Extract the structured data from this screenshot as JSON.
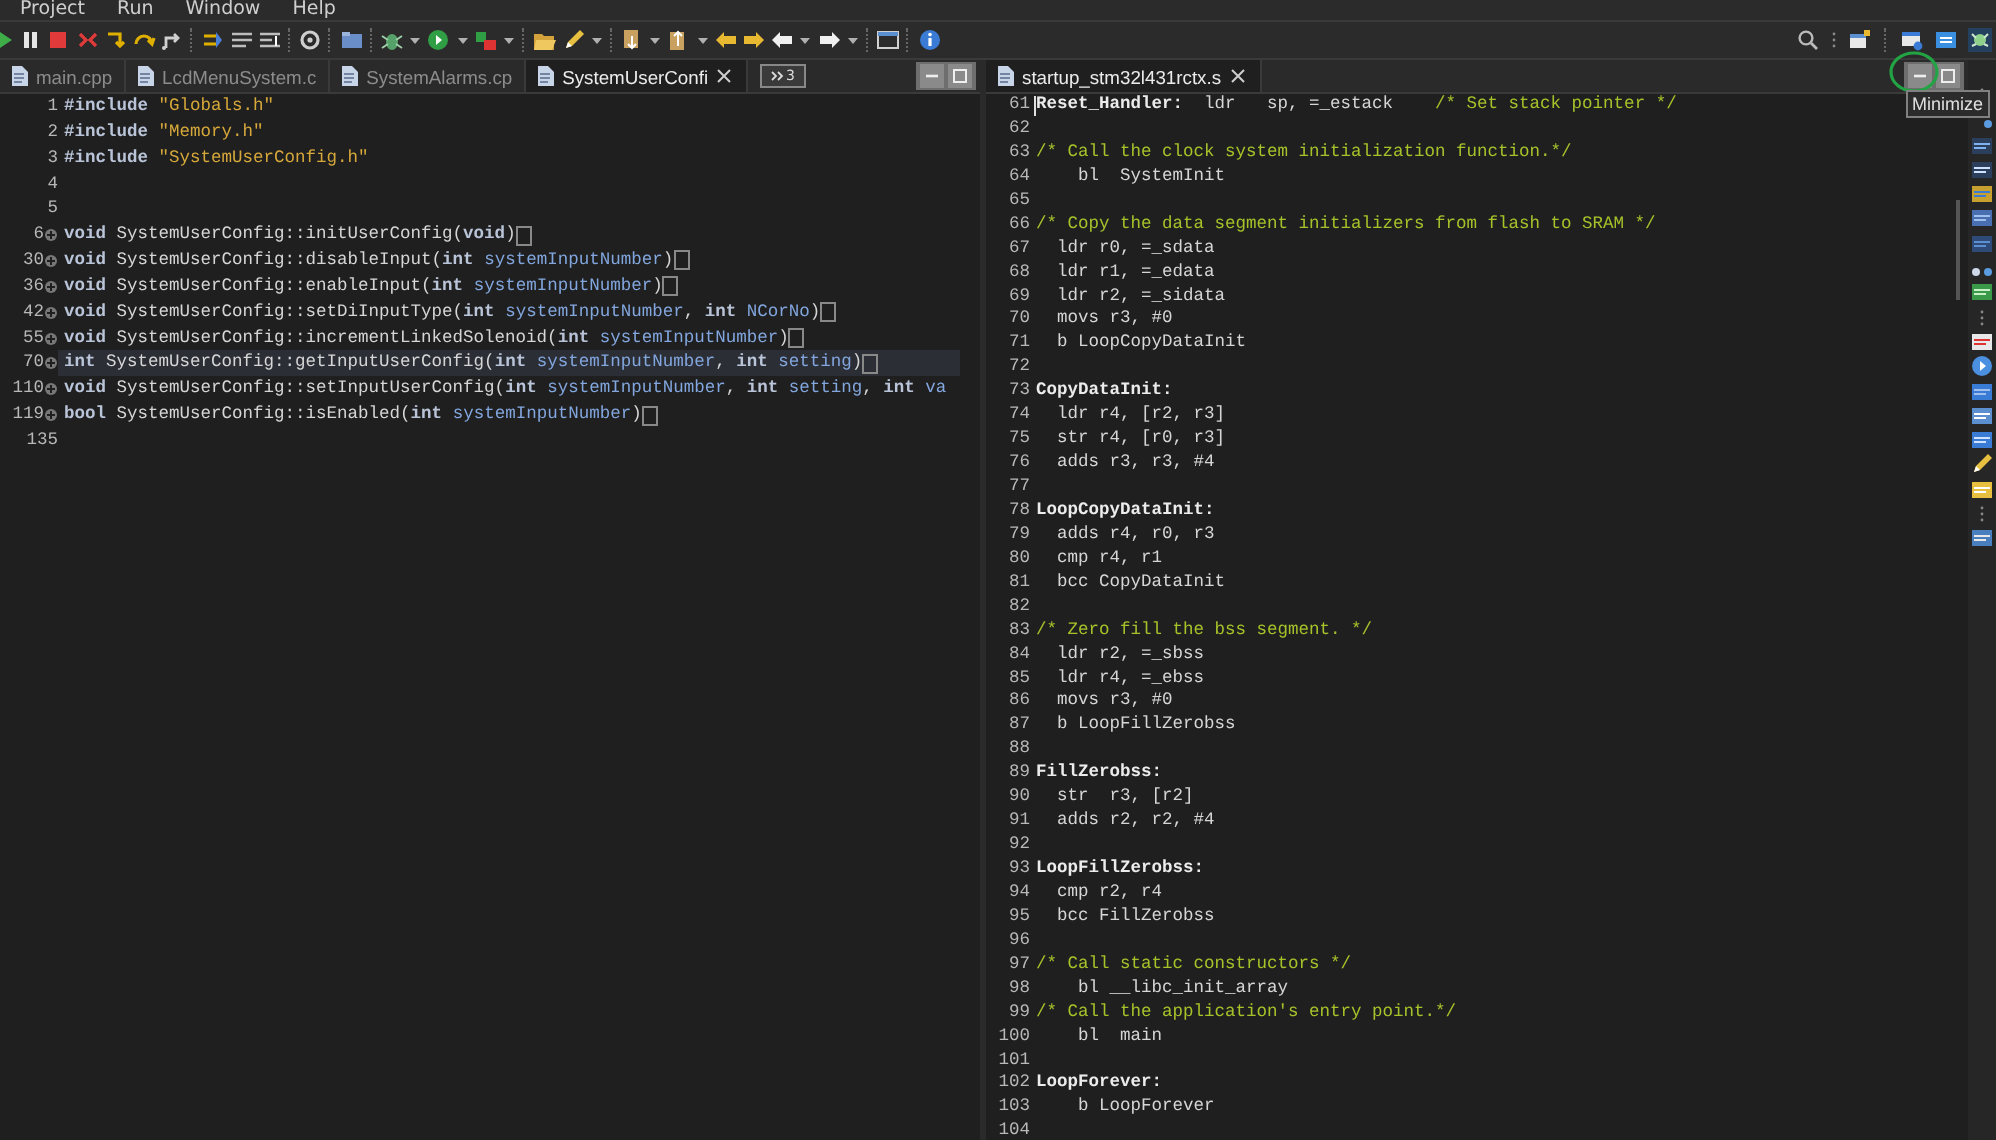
{
  "menu": [
    {
      "label": "Project"
    },
    {
      "label": "Run"
    },
    {
      "label": "Window"
    },
    {
      "label": "Help"
    }
  ],
  "editors": [
    {
      "tabs": [
        {
          "label": "main.cpp",
          "selected": false
        },
        {
          "label": "LcdMenuSystem.c",
          "selected": false
        },
        {
          "label": "SystemAlarms.cp",
          "selected": false
        },
        {
          "label": "SystemUserConfi",
          "selected": true
        }
      ],
      "overflow_count": "3",
      "lines": [
        {
          "number": "1",
          "collapsed": false,
          "current": false,
          "cursor": false,
          "segments": [
            {
              "kind": "keyword",
              "text": "#include"
            },
            {
              "kind": "string",
              "text": " \"Globals.h\""
            }
          ]
        },
        {
          "number": "2",
          "collapsed": false,
          "current": false,
          "cursor": false,
          "segments": [
            {
              "kind": "keyword",
              "text": "#include"
            },
            {
              "kind": "string",
              "text": " \"Memory.h\""
            }
          ]
        },
        {
          "number": "3",
          "collapsed": false,
          "current": false,
          "cursor": false,
          "segments": [
            {
              "kind": "keyword",
              "text": "#include"
            },
            {
              "kind": "string",
              "text": " \"SystemUserConfig.h\""
            }
          ]
        },
        {
          "number": "4",
          "collapsed": false,
          "current": false,
          "cursor": false
        },
        {
          "number": "5",
          "collapsed": false,
          "current": false,
          "cursor": false
        },
        {
          "number": "6",
          "collapsed": true,
          "current": false,
          "cursor": false,
          "segments": [
            {
              "kind": "keyword",
              "text": "void"
            },
            {
              "kind": "plain",
              "text": " SystemUserConfig::initUserConfig("
            },
            {
              "kind": "keyword",
              "text": "void"
            },
            {
              "kind": "plain",
              "text": ")"
            },
            {
              "kind": "elision"
            }
          ]
        },
        {
          "number": "30",
          "collapsed": true,
          "current": false,
          "cursor": false,
          "segments": [
            {
              "kind": "keyword",
              "text": "void"
            },
            {
              "kind": "plain",
              "text": " SystemUserConfig::disableInput("
            },
            {
              "kind": "keyword",
              "text": "int"
            },
            {
              "kind": "param",
              "text": " systemInputNumber"
            },
            {
              "kind": "plain",
              "text": ")"
            },
            {
              "kind": "elision"
            }
          ]
        },
        {
          "number": "36",
          "collapsed": true,
          "current": false,
          "cursor": false,
          "segments": [
            {
              "kind": "keyword",
              "text": "void"
            },
            {
              "kind": "plain",
              "text": " SystemUserConfig::enableInput("
            },
            {
              "kind": "keyword",
              "text": "int"
            },
            {
              "kind": "param",
              "text": " systemInputNumber"
            },
            {
              "kind": "plain",
              "text": ")"
            },
            {
              "kind": "elision"
            }
          ]
        },
        {
          "number": "42",
          "collapsed": true,
          "current": false,
          "cursor": false,
          "segments": [
            {
              "kind": "keyword",
              "text": "void"
            },
            {
              "kind": "plain",
              "text": " SystemUserConfig::setDiInputType("
            },
            {
              "kind": "keyword",
              "text": "int"
            },
            {
              "kind": "param",
              "text": " systemInputNumber"
            },
            {
              "kind": "plain",
              "text": ", "
            },
            {
              "kind": "keyword",
              "text": "int"
            },
            {
              "kind": "param",
              "text": " NCorNo"
            },
            {
              "kind": "plain",
              "text": ")"
            },
            {
              "kind": "elision"
            }
          ]
        },
        {
          "number": "55",
          "collapsed": true,
          "current": false,
          "cursor": false,
          "segments": [
            {
              "kind": "keyword",
              "text": "void"
            },
            {
              "kind": "plain",
              "text": " SystemUserConfig::incrementLinkedSolenoid("
            },
            {
              "kind": "keyword",
              "text": "int"
            },
            {
              "kind": "param",
              "text": " systemInputNumber"
            },
            {
              "kind": "plain",
              "text": ")"
            },
            {
              "kind": "elision"
            }
          ]
        },
        {
          "number": "70",
          "collapsed": true,
          "current": true,
          "cursor": false,
          "segments": [
            {
              "kind": "keyword",
              "text": "int"
            },
            {
              "kind": "plain",
              "text": " SystemUserConfig::getInputUserConfig("
            },
            {
              "kind": "keyword",
              "text": "int"
            },
            {
              "kind": "param",
              "text": " systemInputNumber"
            },
            {
              "kind": "plain",
              "text": ", "
            },
            {
              "kind": "keyword",
              "text": "int"
            },
            {
              "kind": "param",
              "text": " setting"
            },
            {
              "kind": "plain",
              "text": ")"
            },
            {
              "kind": "elision"
            }
          ]
        },
        {
          "number": "110",
          "collapsed": true,
          "current": false,
          "cursor": false,
          "segments": [
            {
              "kind": "keyword",
              "text": "void"
            },
            {
              "kind": "plain",
              "text": " SystemUserConfig::setInputUserConfig("
            },
            {
              "kind": "keyword",
              "text": "int"
            },
            {
              "kind": "param",
              "text": " systemInputNumber"
            },
            {
              "kind": "plain",
              "text": ", "
            },
            {
              "kind": "keyword",
              "text": "int"
            },
            {
              "kind": "param",
              "text": " setting"
            },
            {
              "kind": "plain",
              "text": ", "
            },
            {
              "kind": "keyword",
              "text": "int"
            },
            {
              "kind": "param",
              "text": " va"
            }
          ]
        },
        {
          "number": "119",
          "collapsed": true,
          "current": false,
          "cursor": false,
          "segments": [
            {
              "kind": "keyword",
              "text": "bool"
            },
            {
              "kind": "plain",
              "text": " SystemUserConfig::isEnabled("
            },
            {
              "kind": "keyword",
              "text": "int"
            },
            {
              "kind": "param",
              "text": " systemInputNumber"
            },
            {
              "kind": "plain",
              "text": ")"
            },
            {
              "kind": "elision"
            }
          ]
        },
        {
          "number": "135",
          "collapsed": false,
          "current": false,
          "cursor": false
        }
      ]
    },
    {
      "tabs": [
        {
          "label": "startup_stm32l431rctx.s",
          "selected": true
        }
      ],
      "lines": [
        {
          "number": "61",
          "collapsed": false,
          "current": false,
          "cursor": true,
          "segments": [
            {
              "kind": "label",
              "text": "Reset_Handler:"
            },
            {
              "kind": "plain",
              "text": "  ldr   sp, =_estack    "
            },
            {
              "kind": "comment",
              "text": "/* Set stack pointer */"
            }
          ]
        },
        {
          "number": "62",
          "collapsed": false,
          "current": false,
          "cursor": false
        },
        {
          "number": "63",
          "collapsed": false,
          "current": false,
          "cursor": false,
          "segments": [
            {
              "kind": "comment",
              "text": "/* Call the clock system initialization function.*/"
            }
          ]
        },
        {
          "number": "64",
          "collapsed": false,
          "current": false,
          "cursor": false,
          "segments": [
            {
              "kind": "plain",
              "text": "    bl  SystemInit"
            }
          ]
        },
        {
          "number": "65",
          "collapsed": false,
          "current": false,
          "cursor": false
        },
        {
          "number": "66",
          "collapsed": false,
          "current": false,
          "cursor": false,
          "segments": [
            {
              "kind": "comment",
              "text": "/* Copy the data segment initializers from flash to SRAM */"
            }
          ]
        },
        {
          "number": "67",
          "collapsed": false,
          "current": false,
          "cursor": false,
          "segments": [
            {
              "kind": "plain",
              "text": "  ldr r0, =_sdata"
            }
          ]
        },
        {
          "number": "68",
          "collapsed": false,
          "current": false,
          "cursor": false,
          "segments": [
            {
              "kind": "plain",
              "text": "  ldr r1, =_edata"
            }
          ]
        },
        {
          "number": "69",
          "collapsed": false,
          "current": false,
          "cursor": false,
          "segments": [
            {
              "kind": "plain",
              "text": "  ldr r2, =_sidata"
            }
          ]
        },
        {
          "number": "70",
          "collapsed": false,
          "current": false,
          "cursor": false,
          "segments": [
            {
              "kind": "plain",
              "text": "  movs r3, #0"
            }
          ]
        },
        {
          "number": "71",
          "collapsed": false,
          "current": false,
          "cursor": false,
          "segments": [
            {
              "kind": "plain",
              "text": "  b LoopCopyDataInit"
            }
          ]
        },
        {
          "number": "72",
          "collapsed": false,
          "current": false,
          "cursor": false
        },
        {
          "number": "73",
          "collapsed": false,
          "current": false,
          "cursor": false,
          "segments": [
            {
              "kind": "label",
              "text": "CopyDataInit:"
            }
          ]
        },
        {
          "number": "74",
          "collapsed": false,
          "current": false,
          "cursor": false,
          "segments": [
            {
              "kind": "plain",
              "text": "  ldr r4, [r2, r3]"
            }
          ]
        },
        {
          "number": "75",
          "collapsed": false,
          "current": false,
          "cursor": false,
          "segments": [
            {
              "kind": "plain",
              "text": "  str r4, [r0, r3]"
            }
          ]
        },
        {
          "number": "76",
          "collapsed": false,
          "current": false,
          "cursor": false,
          "segments": [
            {
              "kind": "plain",
              "text": "  adds r3, r3, #4"
            }
          ]
        },
        {
          "number": "77",
          "collapsed": false,
          "current": false,
          "cursor": false
        },
        {
          "number": "78",
          "collapsed": false,
          "current": false,
          "cursor": false,
          "segments": [
            {
              "kind": "label",
              "text": "LoopCopyDataInit:"
            }
          ]
        },
        {
          "number": "79",
          "collapsed": false,
          "current": false,
          "cursor": false,
          "segments": [
            {
              "kind": "plain",
              "text": "  adds r4, r0, r3"
            }
          ]
        },
        {
          "number": "80",
          "collapsed": false,
          "current": false,
          "cursor": false,
          "segments": [
            {
              "kind": "plain",
              "text": "  cmp r4, r1"
            }
          ]
        },
        {
          "number": "81",
          "collapsed": false,
          "current": false,
          "cursor": false,
          "segments": [
            {
              "kind": "plain",
              "text": "  bcc CopyDataInit"
            }
          ]
        },
        {
          "number": "82",
          "collapsed": false,
          "current": false,
          "cursor": false
        },
        {
          "number": "83",
          "collapsed": false,
          "current": false,
          "cursor": false,
          "segments": [
            {
              "kind": "comment",
              "text": "/* Zero fill the bss segment. */"
            }
          ]
        },
        {
          "number": "84",
          "collapsed": false,
          "current": false,
          "cursor": false,
          "segments": [
            {
              "kind": "plain",
              "text": "  ldr r2, =_sbss"
            }
          ]
        },
        {
          "number": "85",
          "collapsed": false,
          "current": false,
          "cursor": false,
          "segments": [
            {
              "kind": "plain",
              "text": "  ldr r4, =_ebss"
            }
          ]
        },
        {
          "number": "86",
          "collapsed": false,
          "current": false,
          "cursor": false,
          "segments": [
            {
              "kind": "plain",
              "text": "  movs r3, #0"
            }
          ]
        },
        {
          "number": "87",
          "collapsed": false,
          "current": false,
          "cursor": false,
          "segments": [
            {
              "kind": "plain",
              "text": "  b LoopFillZerobss"
            }
          ]
        },
        {
          "number": "88",
          "collapsed": false,
          "current": false,
          "cursor": false
        },
        {
          "number": "89",
          "collapsed": false,
          "current": false,
          "cursor": false,
          "segments": [
            {
              "kind": "label",
              "text": "FillZerobss:"
            }
          ]
        },
        {
          "number": "90",
          "collapsed": false,
          "current": false,
          "cursor": false,
          "segments": [
            {
              "kind": "plain",
              "text": "  str  r3, [r2]"
            }
          ]
        },
        {
          "number": "91",
          "collapsed": false,
          "current": false,
          "cursor": false,
          "segments": [
            {
              "kind": "plain",
              "text": "  adds r2, r2, #4"
            }
          ]
        },
        {
          "number": "92",
          "collapsed": false,
          "current": false,
          "cursor": false
        },
        {
          "number": "93",
          "collapsed": false,
          "current": false,
          "cursor": false,
          "segments": [
            {
              "kind": "label",
              "text": "LoopFillZerobss:"
            }
          ]
        },
        {
          "number": "94",
          "collapsed": false,
          "current": false,
          "cursor": false,
          "segments": [
            {
              "kind": "plain",
              "text": "  cmp r2, r4"
            }
          ]
        },
        {
          "number": "95",
          "collapsed": false,
          "current": false,
          "cursor": false,
          "segments": [
            {
              "kind": "plain",
              "text": "  bcc FillZerobss"
            }
          ]
        },
        {
          "number": "96",
          "collapsed": false,
          "current": false,
          "cursor": false
        },
        {
          "number": "97",
          "collapsed": false,
          "current": false,
          "cursor": false,
          "segments": [
            {
              "kind": "comment",
              "text": "/* Call static constructors */"
            }
          ]
        },
        {
          "number": "98",
          "collapsed": false,
          "current": false,
          "cursor": false,
          "segments": [
            {
              "kind": "plain",
              "text": "    bl __libc_init_array"
            }
          ]
        },
        {
          "number": "99",
          "collapsed": false,
          "current": false,
          "cursor": false,
          "segments": [
            {
              "kind": "comment",
              "text": "/* Call the application's entry point.*/"
            }
          ]
        },
        {
          "number": "100",
          "collapsed": false,
          "current": false,
          "cursor": false,
          "segments": [
            {
              "kind": "plain",
              "text": "    bl  main"
            }
          ]
        },
        {
          "number": "101",
          "collapsed": false,
          "current": false,
          "cursor": false
        },
        {
          "number": "102",
          "collapsed": false,
          "current": false,
          "cursor": false,
          "segments": [
            {
              "kind": "label",
              "text": "LoopForever:"
            }
          ]
        },
        {
          "number": "103",
          "collapsed": false,
          "current": false,
          "cursor": false,
          "segments": [
            {
              "kind": "plain",
              "text": "    b LoopForever"
            }
          ]
        },
        {
          "number": "104",
          "collapsed": false,
          "current": false,
          "cursor": false
        }
      ]
    }
  ],
  "tooltip": "Minimize"
}
